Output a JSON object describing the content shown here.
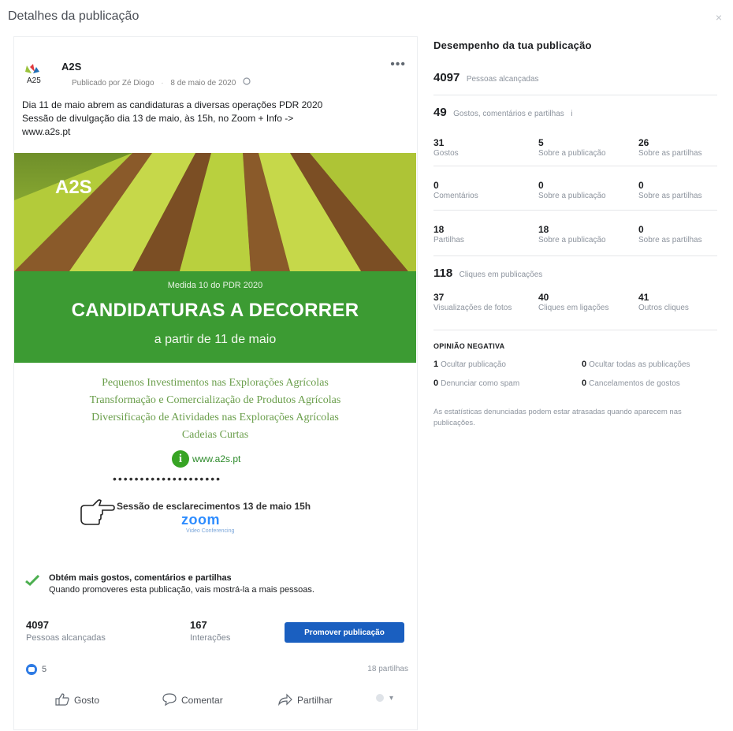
{
  "dialog": {
    "title": "Detalhes da publicação",
    "close": "×"
  },
  "post": {
    "page_name": "A2S",
    "published_by": "Publicado por Zé Diogo",
    "date": "8 de maio de 2020",
    "text_line1": "Dia 11 de maio abrem as candidaturas a diversas operações PDR 2020",
    "text_line2": "Sessão de divulgação dia 13 de maio, às 15h, no Zoom + Info ->",
    "text_line3": "www.a2s.pt",
    "image": {
      "brand": "A2S",
      "measure": "Medida 10 do PDR 2020",
      "headline": "CANDIDATURAS A DECORRER",
      "subheadline": "a partir de 11 de maio",
      "programs": [
        "Pequenos Investimentos nas Explorações Agrícolas",
        "Transformação e Comercialização de Produtos Agrícolas",
        "Diversificação de Atividades nas Explorações Agrícolas",
        "Cadeias Curtas"
      ],
      "info_letter": "i",
      "site": "www.a2s.pt",
      "dots": "••••••••••••••••••••",
      "session": "Sessão de esclarecimentos 13 de maio  15h",
      "zoom": "zoom",
      "zoom_sub": "Video Conferencing"
    },
    "promo": {
      "title": "Obtém mais gostos, comentários e partilhas",
      "desc": "Quando promoveres esta publicação, vais mostrá-la a mais pessoas."
    },
    "stats": {
      "reach_value": "4097",
      "reach_label": "Pessoas alcançadas",
      "interactions_value": "167",
      "interactions_label": "Interações"
    },
    "promote_button": "Promover publicação",
    "reactions_count": "5",
    "shares_text": "18 partilhas",
    "actions": {
      "like": "Gosto",
      "comment": "Comentar",
      "share": "Partilhar"
    }
  },
  "performance": {
    "title": "Desempenho da tua publicação",
    "reached_value": "4097",
    "reached_label": "Pessoas alcançadas",
    "engagement_value": "49",
    "engagement_label": "Gostos, comentários e partilhas",
    "rows": [
      [
        {
          "value": "31",
          "label": "Gostos"
        },
        {
          "value": "5",
          "label": "Sobre a publicação"
        },
        {
          "value": "26",
          "label": "Sobre as partilhas"
        }
      ],
      [
        {
          "value": "0",
          "label": "Comentários"
        },
        {
          "value": "0",
          "label": "Sobre a publicação"
        },
        {
          "value": "0",
          "label": "Sobre as partilhas"
        }
      ],
      [
        {
          "value": "18",
          "label": "Partilhas"
        },
        {
          "value": "18",
          "label": "Sobre a publicação"
        },
        {
          "value": "0",
          "label": "Sobre as partilhas"
        }
      ]
    ],
    "clicks_value": "118",
    "clicks_label": "Cliques em publicações",
    "click_rows": [
      {
        "value": "37",
        "label": "Visualizações de fotos"
      },
      {
        "value": "40",
        "label": "Cliques em ligações"
      },
      {
        "value": "41",
        "label": "Outros cliques"
      }
    ],
    "negative_title": "OPINIÃO NEGATIVA",
    "negative": [
      {
        "value": "1",
        "label": "Ocultar publicação"
      },
      {
        "value": "0",
        "label": "Ocultar todas as publicações"
      },
      {
        "value": "0",
        "label": "Denunciar como spam"
      },
      {
        "value": "0",
        "label": "Cancelamentos de gostos"
      }
    ],
    "note": "As estatísticas denunciadas podem estar atrasadas quando aparecem nas publicações."
  }
}
